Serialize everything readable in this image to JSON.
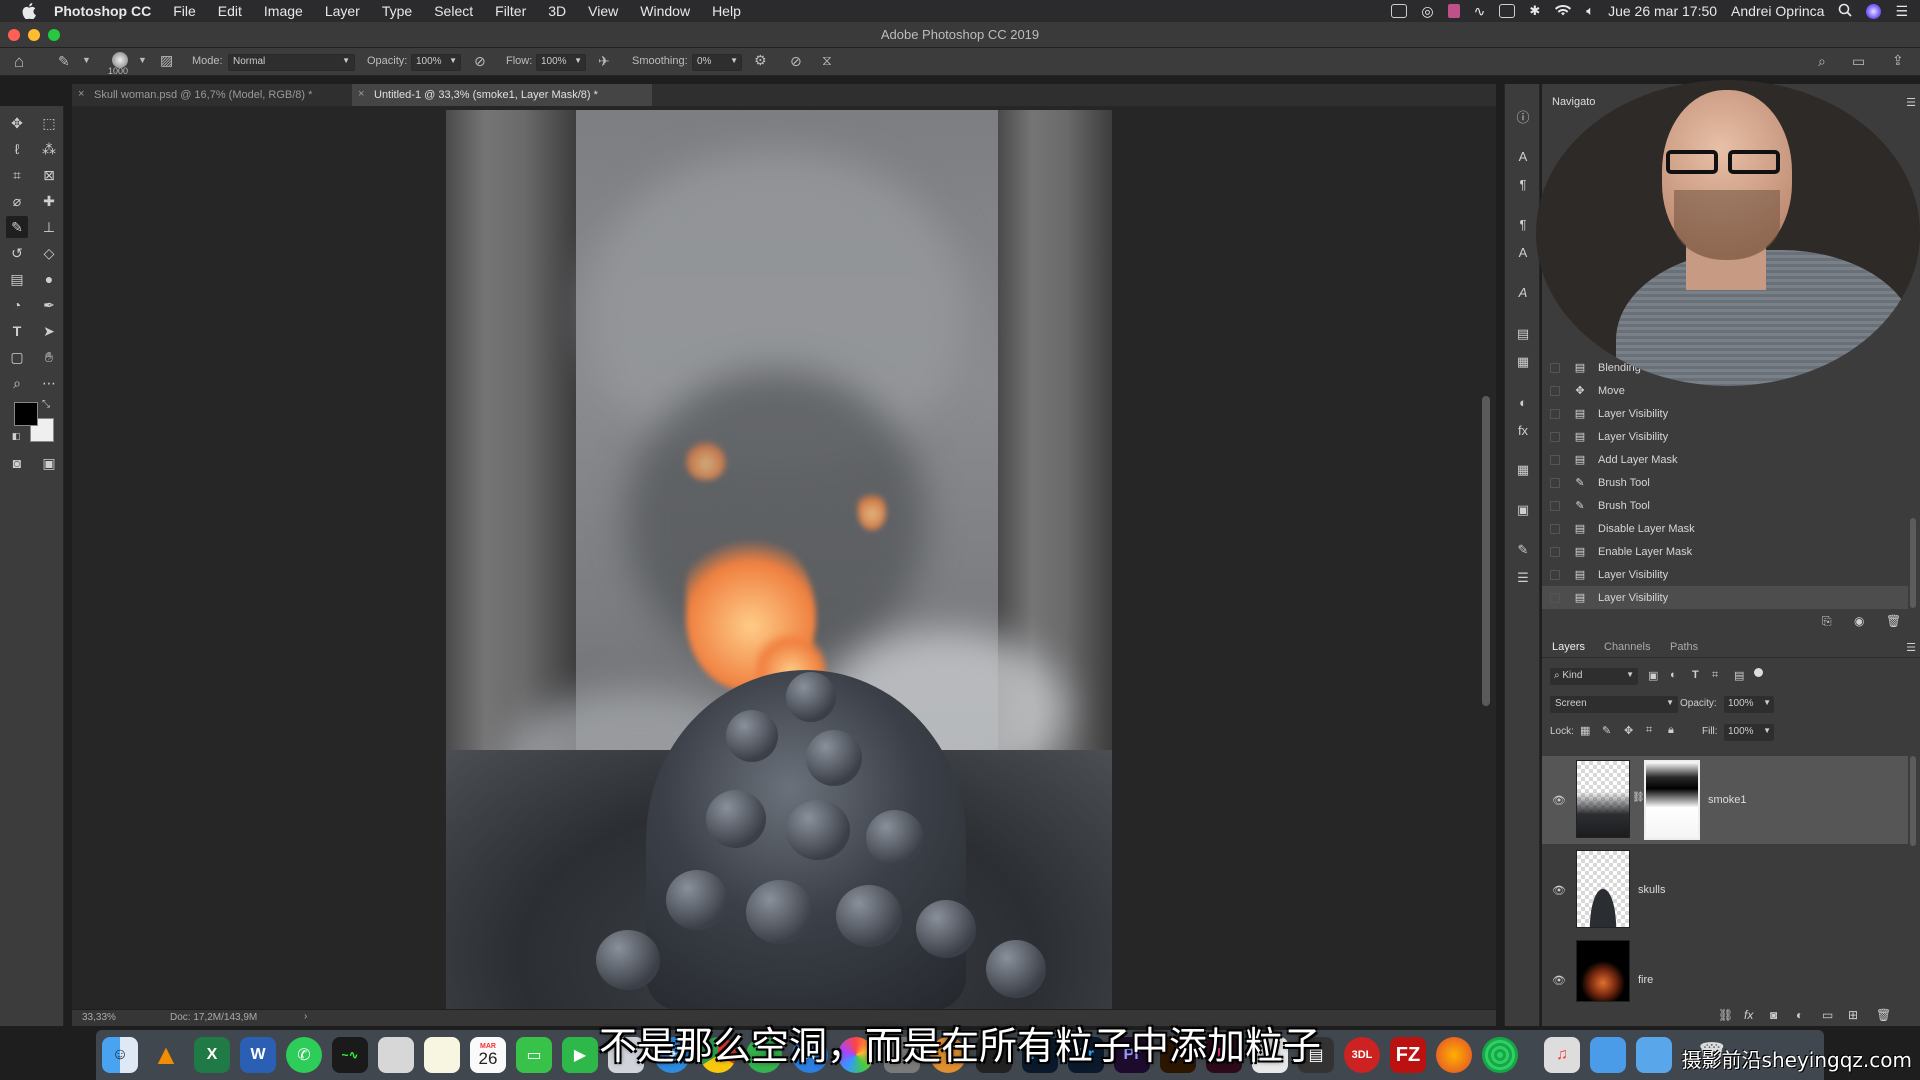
{
  "menubar": {
    "app": "Photoshop CC",
    "items": [
      "File",
      "Edit",
      "Image",
      "Layer",
      "Type",
      "Select",
      "Filter",
      "3D",
      "View",
      "Window",
      "Help"
    ],
    "datetime": "Jue 26 mar  17:50",
    "user": "Andrei Oprinca"
  },
  "window": {
    "title": "Adobe Photoshop CC 2019"
  },
  "options": {
    "brush_size": "1000",
    "mode_label": "Mode:",
    "mode_value": "Normal",
    "opacity_label": "Opacity:",
    "opacity_value": "100%",
    "flow_label": "Flow:",
    "flow_value": "100%",
    "smoothing_label": "Smoothing:",
    "smoothing_value": "0%"
  },
  "tabs": [
    {
      "label": "Skull woman.psd @ 16,7% (Model, RGB/8) *",
      "active": false
    },
    {
      "label": "Untitled-1 @ 33,3% (smoke1, Layer Mask/8) *",
      "active": true
    }
  ],
  "status": {
    "zoom": "33,33%",
    "doc": "Doc: 17,2M/143,9M"
  },
  "history": {
    "panel_tab": "Navigato",
    "items": [
      {
        "label": "Blending",
        "icon": "doc"
      },
      {
        "label": "Move",
        "icon": "move"
      },
      {
        "label": "Layer Visibility",
        "icon": "doc"
      },
      {
        "label": "Layer Visibility",
        "icon": "doc"
      },
      {
        "label": "Add Layer Mask",
        "icon": "doc"
      },
      {
        "label": "Brush Tool",
        "icon": "brush"
      },
      {
        "label": "Brush Tool",
        "icon": "brush"
      },
      {
        "label": "Disable Layer Mask",
        "icon": "doc"
      },
      {
        "label": "Enable Layer Mask",
        "icon": "doc"
      },
      {
        "label": "Layer Visibility",
        "icon": "doc"
      },
      {
        "label": "Layer Visibility",
        "icon": "doc"
      }
    ]
  },
  "layers_panel": {
    "tabs": [
      "Layers",
      "Channels",
      "Paths"
    ],
    "kind_label": "Kind",
    "blend_mode": "Screen",
    "opacity_label": "Opacity:",
    "opacity_value": "100%",
    "lock_label": "Lock:",
    "fill_label": "Fill:",
    "fill_value": "100%",
    "layers": [
      {
        "name": "smoke1",
        "selected": true,
        "has_mask": true
      },
      {
        "name": "skulls",
        "selected": false,
        "has_mask": false
      },
      {
        "name": "fire",
        "selected": false,
        "has_mask": false
      }
    ]
  },
  "dock": {
    "calendar_month": "MAR",
    "calendar_day": "26"
  },
  "subtitle": "不是那么空洞，而是在所有粒子中添加粒子",
  "watermark": "摄影前沿sheyingqz.com",
  "colors": {
    "accent": "#2f6fd1",
    "panel": "#3c3c3c",
    "canvas_bg": "#262626"
  }
}
